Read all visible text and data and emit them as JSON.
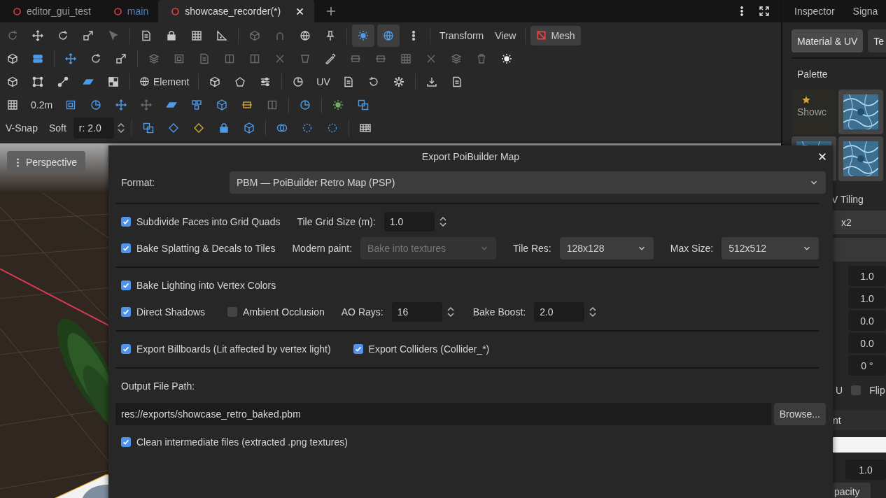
{
  "editor_tabs": [
    {
      "label": "editor_gui_test",
      "selected": false,
      "color": "#9c9c9c"
    },
    {
      "label": "main",
      "selected": false,
      "color": "#4f7fc4"
    },
    {
      "label": "showcase_recorder(*)",
      "selected": true,
      "color": "#dcdcdc"
    }
  ],
  "toolbar_rows": [
    {
      "groups": [
        [
          {
            "kind": "icon"
          },
          {
            "kind": "icon"
          },
          {
            "kind": "icon"
          },
          {
            "kind": "icon"
          },
          {
            "kind": "icon"
          }
        ],
        [
          {
            "kind": "icon"
          },
          {
            "kind": "icon"
          },
          {
            "kind": "icon"
          },
          {
            "kind": "icon"
          }
        ],
        [
          {
            "kind": "icon"
          },
          {
            "kind": "icon"
          },
          {
            "kind": "icon"
          },
          {
            "kind": "icon"
          }
        ],
        [
          {
            "kind": "icon",
            "selected": true
          },
          {
            "kind": "icon",
            "selected": true
          },
          {
            "kind": "icon",
            "selected": false
          }
        ],
        [
          {
            "kind": "menu",
            "label": "Transform"
          },
          {
            "kind": "menu",
            "label": "View"
          }
        ],
        [
          {
            "kind": "toggle",
            "label": "Mesh",
            "selected": true
          }
        ]
      ]
    },
    {
      "groups": [
        [
          {
            "kind": "icon"
          },
          {
            "kind": "icon"
          }
        ],
        [
          {
            "kind": "icon"
          },
          {
            "kind": "icon"
          },
          {
            "kind": "icon"
          }
        ],
        [
          {
            "kind": "icon"
          },
          {
            "kind": "icon"
          },
          {
            "kind": "icon"
          },
          {
            "kind": "icon"
          },
          {
            "kind": "icon"
          },
          {
            "kind": "icon"
          },
          {
            "kind": "icon"
          },
          {
            "kind": "icon"
          },
          {
            "kind": "icon"
          },
          {
            "kind": "icon"
          },
          {
            "kind": "icon"
          },
          {
            "kind": "icon"
          },
          {
            "kind": "icon"
          },
          {
            "kind": "icon"
          },
          {
            "kind": "icon"
          }
        ]
      ]
    },
    {
      "groups": [
        [
          {
            "kind": "icon"
          },
          {
            "kind": "icon"
          },
          {
            "kind": "icon"
          },
          {
            "kind": "icon"
          },
          {
            "kind": "icon"
          }
        ],
        [
          {
            "kind": "mode",
            "label": "Element"
          }
        ],
        [
          {
            "kind": "icon"
          },
          {
            "kind": "icon"
          },
          {
            "kind": "icon"
          }
        ],
        [
          {
            "kind": "icon"
          },
          {
            "kind": "label",
            "label": "UV"
          },
          {
            "kind": "icon"
          },
          {
            "kind": "icon"
          },
          {
            "kind": "icon"
          }
        ],
        [
          {
            "kind": "icon"
          },
          {
            "kind": "icon"
          }
        ]
      ]
    },
    {
      "groups": [
        [
          {
            "kind": "icon"
          },
          {
            "kind": "label",
            "label": "0.2m"
          },
          {
            "kind": "icon"
          },
          {
            "kind": "icon"
          },
          {
            "kind": "icon"
          },
          {
            "kind": "icon"
          },
          {
            "kind": "icon"
          },
          {
            "kind": "icon"
          },
          {
            "kind": "icon"
          },
          {
            "kind": "icon"
          },
          {
            "kind": "icon"
          }
        ],
        [
          {
            "kind": "icon"
          }
        ],
        [
          {
            "kind": "icon"
          },
          {
            "kind": "icon"
          }
        ]
      ]
    },
    {
      "groups": [
        [
          {
            "kind": "label",
            "label": "V-Snap"
          },
          {
            "kind": "label",
            "label": "Soft"
          },
          {
            "kind": "field",
            "value": "r: 2.0"
          }
        ],
        [
          {
            "kind": "icon"
          },
          {
            "kind": "icon"
          },
          {
            "kind": "icon"
          },
          {
            "kind": "icon"
          },
          {
            "kind": "icon"
          }
        ],
        [
          {
            "kind": "icon"
          },
          {
            "kind": "icon"
          },
          {
            "kind": "icon"
          }
        ],
        [
          {
            "kind": "icon"
          }
        ]
      ]
    }
  ],
  "viewport": {
    "view_button": "Perspective"
  },
  "dock": {
    "tabs": [
      {
        "label": "Inspector"
      },
      {
        "label": "Signa"
      }
    ],
    "subtabs": [
      {
        "label": "Material & UV",
        "selected": true
      },
      {
        "label": "Te",
        "selected": false
      }
    ],
    "palette_title": "Palette",
    "palette": [
      {
        "kind": "swatch",
        "label": "Showc",
        "starred": true
      },
      {
        "kind": "picture"
      },
      {
        "kind": "picture"
      },
      {
        "kind": "picture"
      }
    ],
    "tiling_label": "V Tiling",
    "tiling_value": "x2",
    "values": [
      "1.0",
      "1.0",
      "0.0",
      "0.0",
      "0 °"
    ],
    "flip": {
      "label_left": "U",
      "label": "Flip",
      "checked": false
    },
    "section": "nt",
    "opacity_value": "1.0",
    "opacity_button": "pacity"
  },
  "dialog": {
    "title": "Export PoiBuilder Map",
    "format": {
      "label": "Format:",
      "value": "PBM — PoiBuilder Retro Map (PSP)"
    },
    "sections": [
      [
        {
          "items": [
            {
              "kind": "checkbox",
              "label": "Subdivide Faces into Grid Quads",
              "checked": true
            },
            {
              "kind": "spin",
              "label": "Tile Grid Size (m):",
              "value": "1.0"
            }
          ]
        },
        {
          "items": [
            {
              "kind": "checkbox",
              "label": "Bake Splatting & Decals to Tiles",
              "checked": true
            },
            {
              "kind": "select",
              "label": "Modern paint:",
              "value": "Bake into textures",
              "disabled": true
            },
            {
              "kind": "select",
              "label": "Tile Res:",
              "value": "128x128",
              "disabled": false
            },
            {
              "kind": "select",
              "label": "Max Size:",
              "value": "512x512",
              "disabled": false
            }
          ]
        }
      ],
      [
        {
          "items": [
            {
              "kind": "checkbox",
              "label": "Bake Lighting into Vertex Colors",
              "checked": true
            }
          ]
        },
        {
          "items": [
            {
              "kind": "checkbox",
              "label": "Direct Shadows",
              "checked": true
            },
            {
              "kind": "checkbox",
              "label": "Ambient Occlusion",
              "checked": false
            },
            {
              "kind": "spin",
              "label": "AO Rays:",
              "value": "16"
            },
            {
              "kind": "spin",
              "label": "Bake Boost:",
              "value": "2.0"
            }
          ]
        }
      ],
      [
        {
          "items": [
            {
              "kind": "checkbox",
              "label": "Export Billboards (Lit affected by vertex light)",
              "checked": true
            },
            {
              "kind": "checkbox",
              "label": "Export Colliders (Collider_*)",
              "checked": true
            }
          ]
        }
      ],
      [
        {
          "items": [
            {
              "kind": "label",
              "label": "Output File Path:"
            }
          ]
        },
        {
          "items": [
            {
              "kind": "path",
              "value": "res://exports/showcase_retro_baked.pbm",
              "button": "Browse..."
            }
          ]
        },
        {
          "items": [
            {
              "kind": "checkbox",
              "label": "Clean intermediate files (extracted .png textures)",
              "checked": true
            }
          ]
        }
      ]
    ]
  }
}
